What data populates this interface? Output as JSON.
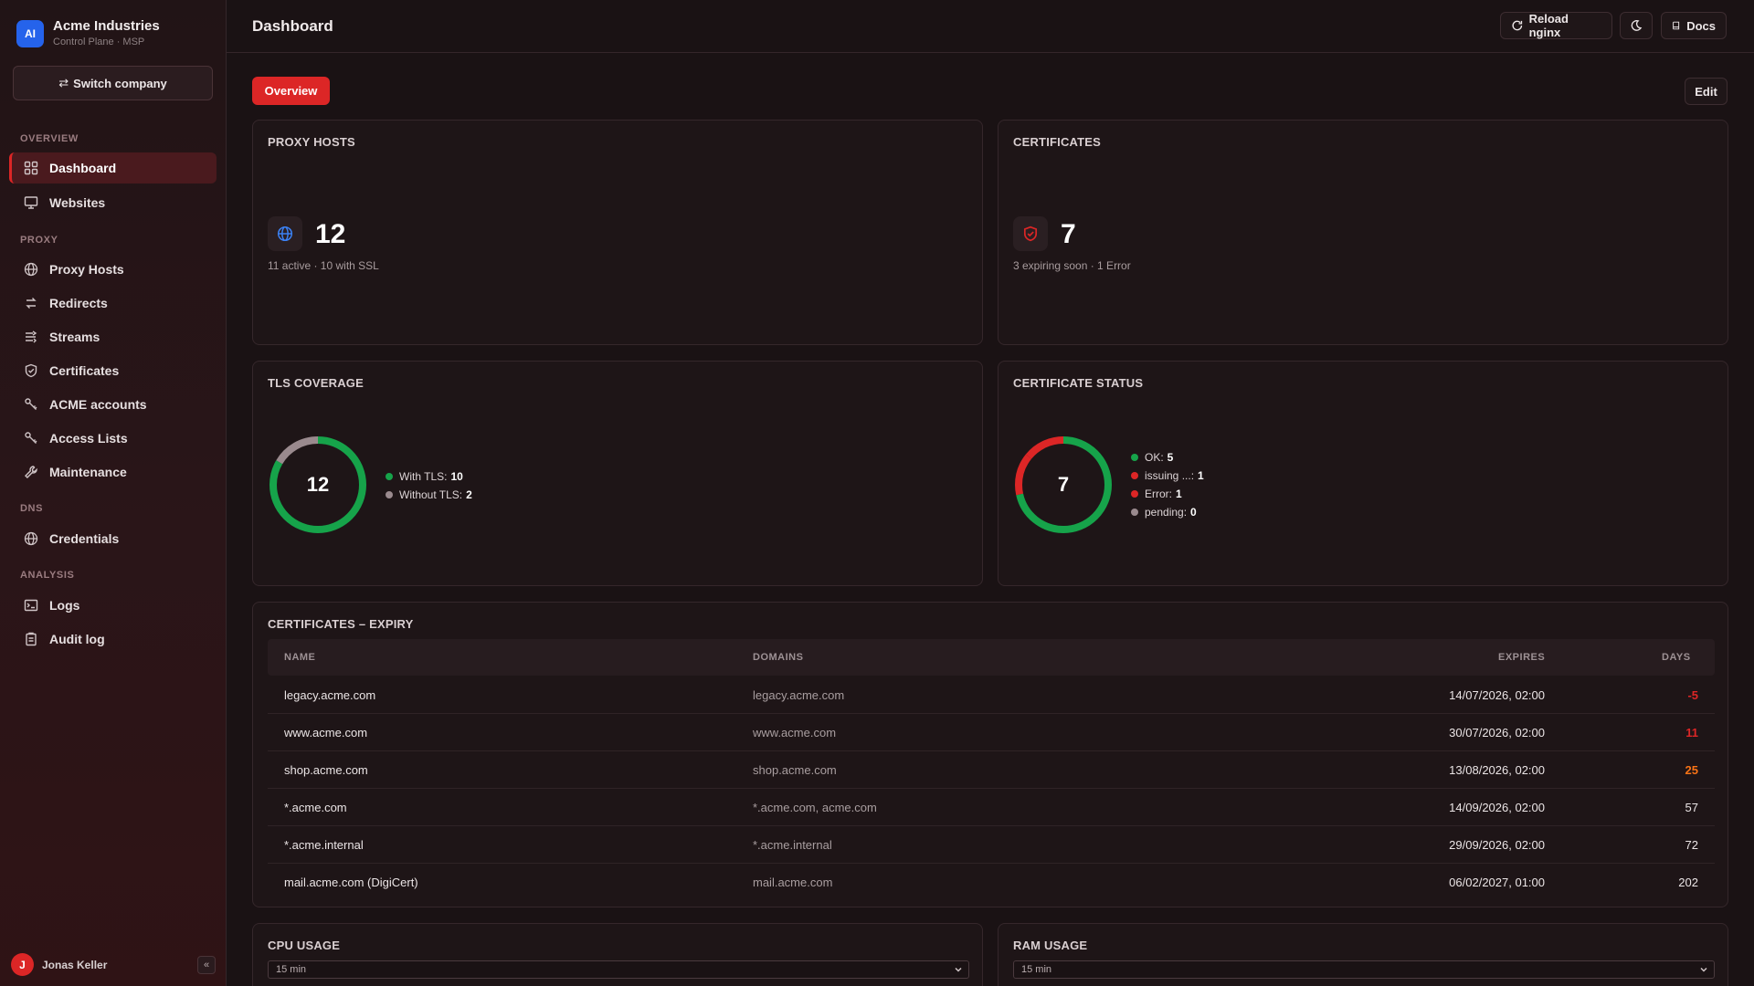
{
  "brand": {
    "logo": "AI",
    "name": "Acme Industries",
    "subtitle": "Control Plane · MSP"
  },
  "switch_company": {
    "icon": "swap-icon",
    "label": "Switch company"
  },
  "nav": {
    "sections": [
      "OVERVIEW",
      "PROXY",
      "DNS",
      "ANALYSIS"
    ],
    "items": [
      {
        "label": "Dashboard",
        "icon": "grid-icon",
        "active": true
      },
      {
        "label": "Websites",
        "icon": "monitor-icon"
      },
      {
        "label": "Proxy Hosts",
        "icon": "globe-icon"
      },
      {
        "label": "Redirects",
        "icon": "redirect-icon"
      },
      {
        "label": "Streams",
        "icon": "streams-icon"
      },
      {
        "label": "Certificates",
        "icon": "shield-icon"
      },
      {
        "label": "ACME accounts",
        "icon": "key-icon"
      },
      {
        "label": "Access Lists",
        "icon": "key-icon"
      },
      {
        "label": "Maintenance",
        "icon": "wrench-icon"
      },
      {
        "label": "Credentials",
        "icon": "globe-icon"
      },
      {
        "label": "Logs",
        "icon": "terminal-icon"
      },
      {
        "label": "Audit log",
        "icon": "clipboard-icon"
      }
    ]
  },
  "user": {
    "initial": "J",
    "name": "Jonas Keller",
    "collapse": "«"
  },
  "topbar": {
    "title": "Dashboard",
    "reload": "Reload nginx",
    "theme_icon": "moon-icon",
    "docs": "Docs"
  },
  "tabs": {
    "overview": "Overview",
    "edit": "Edit"
  },
  "colors": {
    "accent": "#dc2626",
    "ok": "#16a34a",
    "warning": "#f97316",
    "neutral": "#9a8a8e",
    "link_blue": "#3b82f6"
  },
  "proxy_hosts": {
    "title": "PROXY HOSTS",
    "value": "12",
    "sub": "11 active · 10 with SSL"
  },
  "certificates": {
    "title": "CERTIFICATES",
    "value": "7",
    "sub": "3 expiring soon · 1 Error"
  },
  "tls_coverage": {
    "title": "TLS COVERAGE",
    "total": "12",
    "legend": [
      {
        "label": "With TLS:",
        "value": "10",
        "color": "#16a34a"
      },
      {
        "label": "Without TLS:",
        "value": "2",
        "color": "#9a8a8e"
      }
    ]
  },
  "cert_status": {
    "title": "CERTIFICATE STATUS",
    "total": "7",
    "legend": [
      {
        "label": "OK:",
        "value": "5",
        "color": "#16a34a"
      },
      {
        "label": "issuing ...:",
        "value": "1",
        "color": "#dc2626"
      },
      {
        "label": "Error:",
        "value": "1",
        "color": "#dc2626"
      },
      {
        "label": "pending:",
        "value": "0",
        "color": "#9a8a8e"
      }
    ]
  },
  "chart_data": [
    {
      "type": "pie",
      "title": "TLS COVERAGE",
      "categories": [
        "With TLS",
        "Without TLS"
      ],
      "values": [
        10,
        2
      ]
    },
    {
      "type": "pie",
      "title": "CERTIFICATE STATUS",
      "categories": [
        "OK",
        "issuing ...",
        "Error",
        "pending"
      ],
      "values": [
        5,
        1,
        1,
        0
      ]
    }
  ],
  "expiry": {
    "title": "CERTIFICATES – EXPIRY",
    "columns": [
      "NAME",
      "DOMAINS",
      "EXPIRES",
      "DAYS"
    ],
    "rows": [
      {
        "name": "legacy.acme.com",
        "domains": "legacy.acme.com",
        "expires": "14/07/2026, 02:00",
        "days": "-5",
        "level": "danger"
      },
      {
        "name": "www.acme.com",
        "domains": "www.acme.com",
        "expires": "30/07/2026, 02:00",
        "days": "11",
        "level": "danger"
      },
      {
        "name": "shop.acme.com",
        "domains": "shop.acme.com",
        "expires": "13/08/2026, 02:00",
        "days": "25",
        "level": "warning"
      },
      {
        "name": "*.acme.com",
        "domains": "*.acme.com, acme.com",
        "expires": "14/09/2026, 02:00",
        "days": "57",
        "level": "normal"
      },
      {
        "name": "*.acme.internal",
        "domains": "*.acme.internal",
        "expires": "29/09/2026, 02:00",
        "days": "72",
        "level": "normal"
      },
      {
        "name": "mail.acme.com (DigiCert)",
        "domains": "mail.acme.com",
        "expires": "06/02/2027, 01:00",
        "days": "202",
        "level": "normal"
      }
    ]
  },
  "cpu": {
    "title": "CPU USAGE",
    "range": "15 min"
  },
  "ram": {
    "title": "RAM USAGE",
    "range": "15 min"
  }
}
